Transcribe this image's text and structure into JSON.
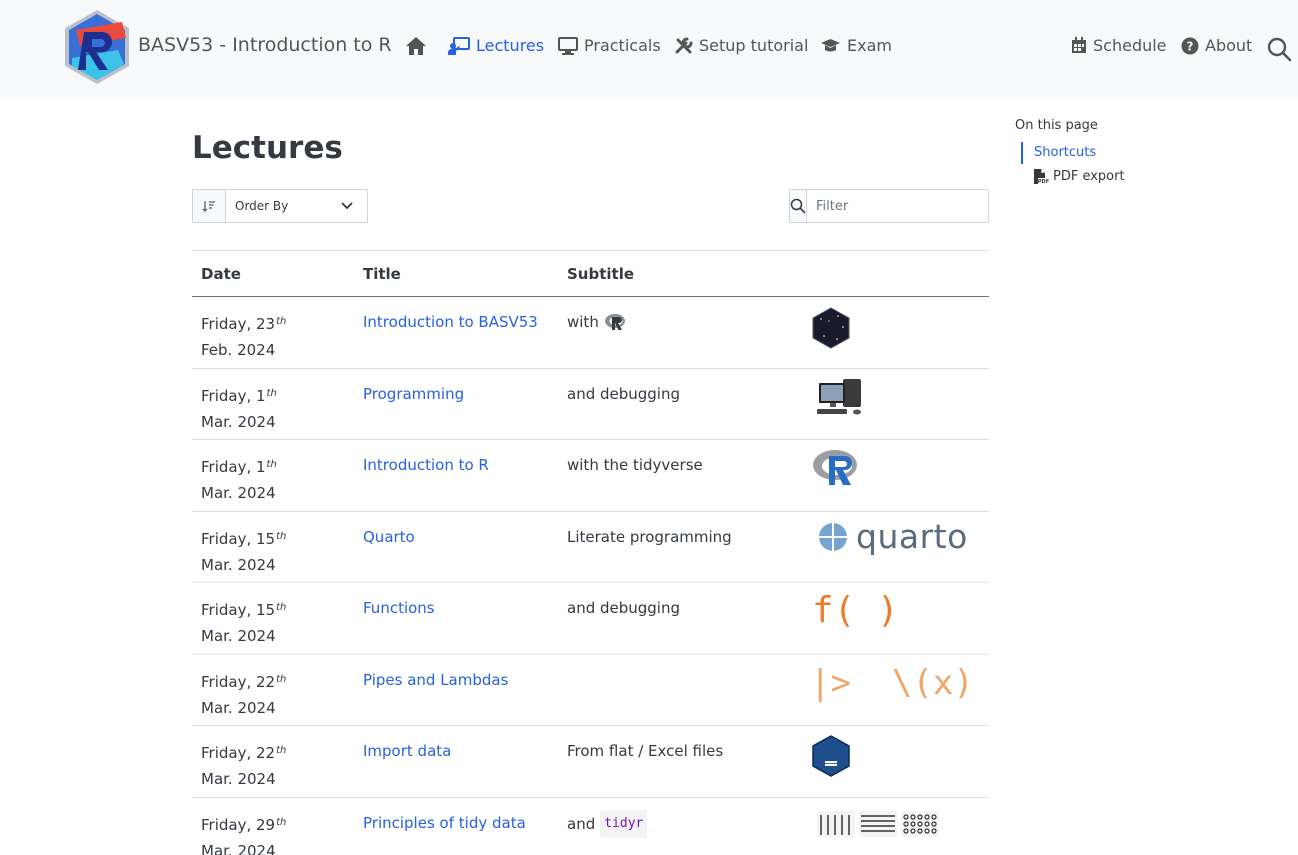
{
  "navbar": {
    "brand": "BASV53 - Introduction to R",
    "links": [
      {
        "label": "Lectures",
        "icon": "presentation-icon"
      },
      {
        "label": "Practicals",
        "icon": "monitor-icon"
      },
      {
        "label": "Setup tutorial",
        "icon": "tools-icon"
      },
      {
        "label": "Exam",
        "icon": "mortarboard-icon"
      },
      {
        "label": "Schedule",
        "icon": "calendar-icon"
      },
      {
        "label": "About",
        "icon": "question-circle-icon"
      }
    ],
    "active_color": "#2761e3"
  },
  "page": {
    "title": "Lectures"
  },
  "controls": {
    "order_by": "Order By",
    "filter_placeholder": "Filter"
  },
  "table": {
    "headers": [
      "Date",
      "Title",
      "Subtitle"
    ],
    "rows": [
      {
        "day": "Friday, 23",
        "sup": "th",
        "month": "Feb. 2024",
        "title": "Introduction to BASV53",
        "subtitle": "with",
        "image": "tidyverse-hex"
      },
      {
        "day": "Friday, 1",
        "sup": "th",
        "month": "Mar. 2024",
        "title": "Programming",
        "subtitle": "and debugging",
        "image": "computer"
      },
      {
        "day": "Friday, 1",
        "sup": "th",
        "month": "Mar. 2024",
        "title": "Introduction to R",
        "subtitle": "with the tidyverse",
        "image": "r-logo"
      },
      {
        "day": "Friday, 15",
        "sup": "th",
        "month": "Mar. 2024",
        "title": "Quarto",
        "subtitle": "Literate programming",
        "image": "quarto-logo",
        "image_text": "quarto"
      },
      {
        "day": "Friday, 15",
        "sup": "th",
        "month": "Mar. 2024",
        "title": "Functions",
        "subtitle": "and debugging",
        "image": "function-glyph",
        "image_text": "f( )"
      },
      {
        "day": "Friday, 22",
        "sup": "th",
        "month": "Mar. 2024",
        "title": "Pipes and Lambdas",
        "subtitle": "",
        "image": "pipe-lambda-glyph",
        "image_text": "|>  \\(x)"
      },
      {
        "day": "Friday, 22",
        "sup": "th",
        "month": "Mar. 2024",
        "title": "Import data",
        "subtitle": "From flat / Excel files",
        "image": "readr-hex"
      },
      {
        "day": "Friday, 29",
        "sup": "th",
        "month": "Mar. 2024",
        "title": "Principles of tidy data",
        "subtitle": "and",
        "subtitle_code": "tidyr",
        "image": "tidy-data-diagram"
      }
    ]
  },
  "toc": {
    "title": "On this page",
    "links": [
      "Shortcuts"
    ],
    "pdf_label": "PDF export"
  }
}
